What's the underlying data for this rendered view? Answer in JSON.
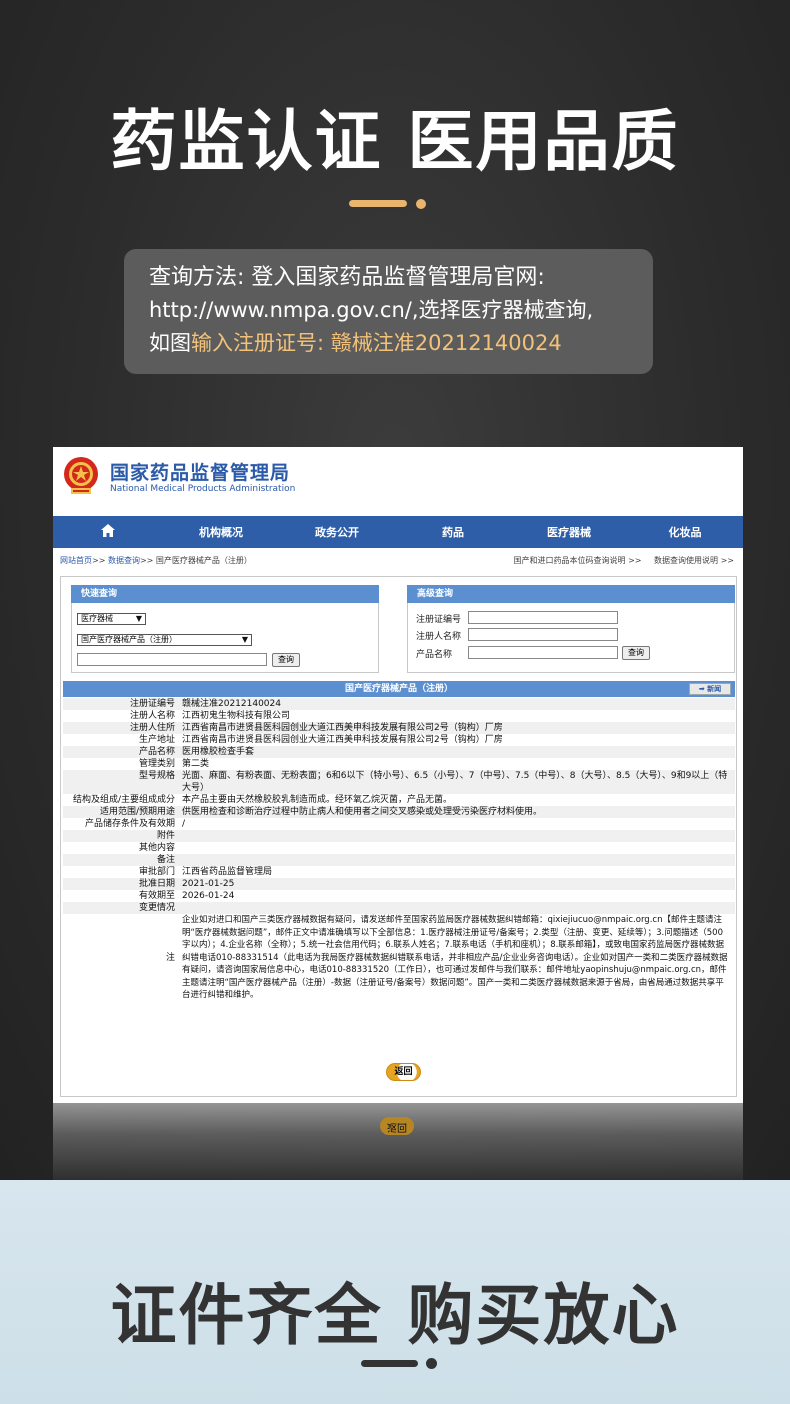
{
  "hero": {
    "headline": "药监认证 医用品质",
    "info_line1": "查询方法: 登入国家药品监督管理局官网:",
    "info_line2": "http://www.nmpa.gov.cn/,选择医疗器械查询,",
    "info_line3_prefix": "如图",
    "info_line3_highlight": "输入注册证号:  赣械注准20212140024",
    "accent_color": "#e9b46e"
  },
  "site": {
    "title": "国家药品监督管理局",
    "subtitle": "National Medical Products Administration",
    "nav": [
      "机构概况",
      "政务公开",
      "药品",
      "医疗器械",
      "化妆品"
    ],
    "breadcrumb": {
      "home": "网站首页",
      "sep": ">>",
      "query": "数据查询",
      "current": "国产医疗器械产品（注册）"
    },
    "top_links": [
      "国产和进口药品本位码查询说明 >>",
      "数据查询使用说明 >>"
    ]
  },
  "quick_search": {
    "title": "快速查询",
    "category_select": "医疗器械",
    "type_select": "国产医疗器械产品（注册）",
    "button": "查询"
  },
  "advanced_search": {
    "title": "高级查询",
    "labels": [
      "注册证编号",
      "注册人名称",
      "产品名称"
    ],
    "button": "查询"
  },
  "result": {
    "title": "国产医疗器械产品（注册）",
    "new_button": "新闻",
    "rows": [
      {
        "k": "注册证编号",
        "v": "赣械注准20212140024"
      },
      {
        "k": "注册人名称",
        "v": "江西初鬼生物科技有限公司"
      },
      {
        "k": "注册人住所",
        "v": "江西省南昌市进贤县医科园创业大道江西美申科技发展有限公司2号（钩构）厂房"
      },
      {
        "k": "生产地址",
        "v": "江西省南昌市进贤县医科园创业大道江西美申科技发展有限公司2号（钩构）厂房"
      },
      {
        "k": "产品名称",
        "v": "医用橡胶检查手套"
      },
      {
        "k": "管理类别",
        "v": "第二类"
      },
      {
        "k": "型号规格",
        "v": "光面、麻面、有粉表面、无粉表面；6和6以下（特小号）、6.5（小号）、7（中号）、7.5（中号）、8（大号）、8.5（大号）、9和9以上（特大号）"
      },
      {
        "k": "结构及组成/主要组成成分",
        "v": "本产品主要由天然橡胶胶乳制造而成。经环氧乙烷灭菌，产品无菌。"
      },
      {
        "k": "适用范围/预期用途",
        "v": "供医用检查和诊断治疗过程中防止病人和使用者之间交叉感染或处理受污染医疗材料使用。"
      },
      {
        "k": "产品储存条件及有效期",
        "v": "/"
      },
      {
        "k": "附件",
        "v": ""
      },
      {
        "k": "其他内容",
        "v": ""
      },
      {
        "k": "备注",
        "v": ""
      },
      {
        "k": "审批部门",
        "v": "江西省药品监督管理局"
      },
      {
        "k": "批准日期",
        "v": "2021-01-25"
      },
      {
        "k": "有效期至",
        "v": "2026-01-24"
      },
      {
        "k": "变更情况",
        "v": ""
      }
    ],
    "notes_label": "注",
    "notes": "企业如对进口和国产三类医疗器械数据有疑问，请发送邮件至国家药监局医疗器械数据纠错邮箱：qixiejiucuo@nmpaic.org.cn【邮件主题请注明“医疗器械数据问题”，邮件正文中请准确填写以下全部信息：1.医疗器械注册证号/备案号；2.类型（注册、变更、延续等）；3.问题描述（500字以内）；4.企业名称（全称）；5.统一社会信用代码；6.联系人姓名；7.联系电话（手机和座机）；8.联系邮箱】，或致电国家药监局医疗器械数据纠错电话010-88331514（此电话为我局医疗器械数据纠错联系电话，并非相应产品/企业业务咨询电话）。企业如对国产一类和二类医疗器械数据有疑问，请咨询国家局信息中心，电话010-88331520（工作日），也可通过发邮件与我们联系：邮件地址yaopinshuju@nmpaic.org.cn，邮件主题请注明“国产医疗器械产品（注册）-数据（注册证号/备案号）数据问题”。国产一类和二类医疗器械数据来源于省局，由省局通过数据共享平台进行纠错和维护。",
    "back_button": "返回"
  },
  "footer": {
    "headline": "证件齐全 购买放心"
  }
}
